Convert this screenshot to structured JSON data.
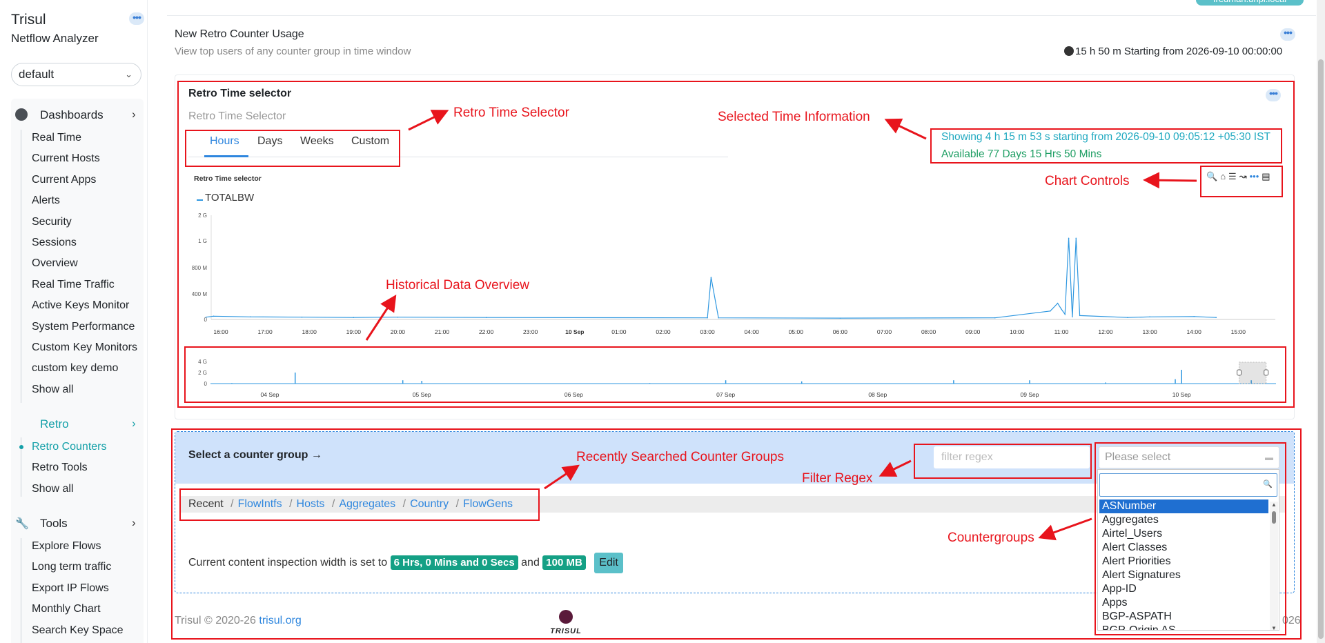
{
  "sidebar": {
    "app_name": "Trisul",
    "app_subtitle": "Netflow Analyzer",
    "context_select": "default",
    "dashboards_label": "Dashboards",
    "dashboards_items": [
      "Real Time",
      "Current Hosts",
      "Current Apps",
      "Alerts",
      "Security",
      "Sessions",
      "Overview",
      "Real Time Traffic",
      "Active Keys Monitor",
      "System Performance",
      "Custom Key Monitors",
      "custom key demo",
      "Show all"
    ],
    "retro_label": "Retro",
    "retro_items": [
      "Retro Counters",
      "Retro Tools",
      "Show all"
    ],
    "tools_label": "Tools",
    "tools_items": [
      "Explore Flows",
      "Long term traffic",
      "Export IP Flows",
      "Monthly Chart",
      "Search Key Space"
    ]
  },
  "top_pill": "fredman.unpi.local",
  "page": {
    "title": "New Retro Counter Usage",
    "subtitle": "View top users of any counter group in time window",
    "time_window": "15 h 50 m Starting from 2026-09-10 00:00:00"
  },
  "retro_card": {
    "title": "Retro Time selector",
    "subtitle": "Retro Time Selector",
    "tabs": [
      "Hours",
      "Days",
      "Weeks",
      "Custom"
    ],
    "active_tab": "Hours",
    "selected_info": "Showing 4 h 15 m 53 s starting from 2026-09-10 09:05:12 +05:30 IST",
    "available_info": "Available 77 Days 15 Hrs 50 Mins",
    "chart_controls": [
      "zoom-icon",
      "home-icon",
      "menu-icon",
      "line-chart-icon",
      "more-icon",
      "export-icon"
    ]
  },
  "chart_data": [
    {
      "type": "line",
      "title": "Retro Time selector",
      "legend": [
        "TOTALBW"
      ],
      "legend_placement": "top-left",
      "yticks": [
        "0",
        "400 M",
        "800 M",
        "1 G",
        "2 G"
      ],
      "xticks": [
        "16:00",
        "17:00",
        "18:00",
        "19:00",
        "20:00",
        "21:00",
        "22:00",
        "23:00",
        "10 Sep",
        "01:00",
        "02:00",
        "03:00",
        "04:00",
        "05:00",
        "06:00",
        "07:00",
        "08:00",
        "09:00",
        "10:00",
        "11:00",
        "12:00",
        "13:00",
        "14:00",
        "15:00"
      ],
      "color": "#2e97e0",
      "series": [
        {
          "name": "TOTALBW",
          "x": [
            "15:50",
            "16:40",
            "17:50",
            "19:00",
            "20:00",
            "22:00",
            "03:00",
            "03:05",
            "03:15",
            "06:00",
            "09:30",
            "10:45",
            "10:55",
            "11:00",
            "11:05",
            "11:10",
            "11:15",
            "11:20",
            "11:25",
            "12:30",
            "13:00",
            "14:00",
            "14:30",
            "15:40"
          ],
          "y": [
            50,
            40,
            35,
            30,
            35,
            30,
            25,
            650,
            25,
            20,
            25,
            130,
            250,
            160,
            80,
            1100,
            40,
            1100,
            60,
            30,
            40,
            45,
            30,
            35
          ]
        }
      ]
    },
    {
      "type": "area",
      "title": "",
      "yticks": [
        "0",
        "2 G",
        "4 G"
      ],
      "xticks": [
        "04 Sep",
        "05 Sep",
        "06 Sep",
        "07 Sep",
        "08 Sep",
        "09 Sep",
        "10 Sep"
      ],
      "selection": [
        "2026-09-10 09:05:12",
        "2026-09-10 13:21:05"
      ],
      "series": [
        {
          "name": "TOTALBW",
          "x": [
            "03 Sep 18:00",
            "04 Sep 04:00",
            "04 Sep 21:00",
            "05 Sep 00:00",
            "06 Sep 12:00",
            "07 Sep 00:00",
            "07 Sep 12:00",
            "08 Sep 12:00",
            "09 Sep 00:00",
            "09 Sep 12:00",
            "09 Sep 23:00",
            "10 Sep 00:00",
            "10 Sep 11:00"
          ],
          "y": [
            0.1,
            2.0,
            0.6,
            0.5,
            0.1,
            0.6,
            0.4,
            0.6,
            0.6,
            0.2,
            0.8,
            2.5,
            0.6
          ]
        }
      ]
    }
  ],
  "counter_group": {
    "title": "Select a counter group →",
    "filter_placeholder": "filter regex",
    "recent_label": "Recent",
    "recent_links": [
      "FlowIntfs",
      "Hosts",
      "Aggregates",
      "Country",
      "FlowGens"
    ],
    "inspect_text": "Current content inspection width is set to",
    "inspect_badge1": "6 Hrs, 0 Mins and 0 Secs",
    "inspect_and": "and",
    "inspect_badge2": "100 MB",
    "edit_label": "Edit",
    "select_placeholder": "Please select",
    "options": [
      "ASNumber",
      "Aggregates",
      "Airtel_Users",
      "Alert Classes",
      "Alert Priorities",
      "Alert Signatures",
      "App-ID",
      "Apps",
      "BGP-ASPATH",
      "BGP-Origin AS"
    ],
    "highlighted": "ASNumber"
  },
  "footer": {
    "copyright": "Trisul © 2020-26",
    "link": "trisul.org",
    "logo_text": "TRISUL",
    "right_text": "026"
  },
  "annotations": {
    "retro_time_selector": "Retro Time Selector",
    "selected_time_info": "Selected Time Information",
    "chart_controls": "Chart Controls",
    "historical": "Historical Data Overview",
    "recent_groups": "Recently Searched Counter Groups",
    "filter_regex": "Filter Regex",
    "countergroups": "Countergroups",
    "color": "#e8141c"
  }
}
